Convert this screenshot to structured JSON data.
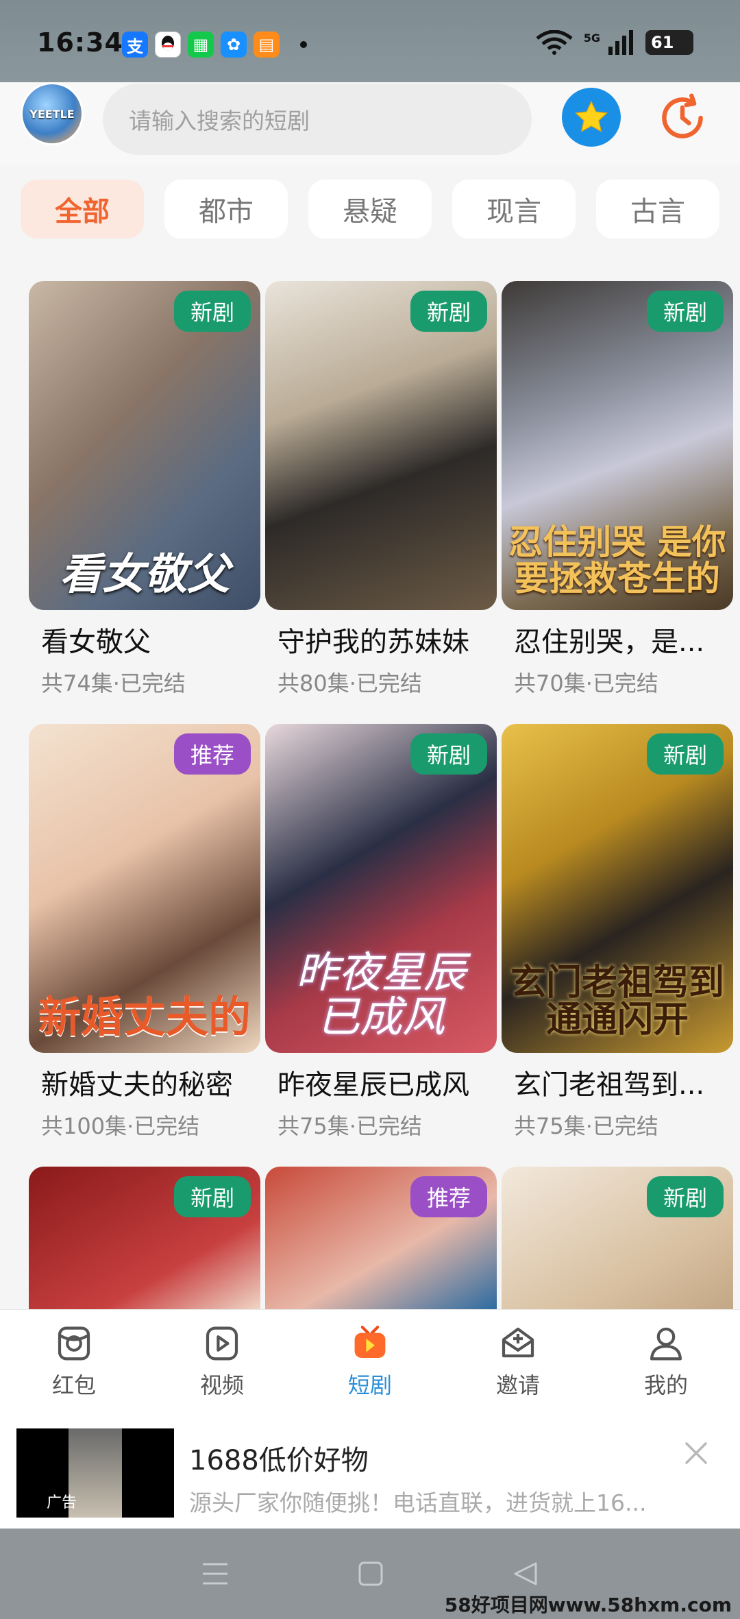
{
  "status": {
    "time": "16:34",
    "network": "5G",
    "battery": "61"
  },
  "header": {
    "avatar_text": "YEETLE",
    "search_placeholder": "请输入搜索的短剧"
  },
  "tabs": [
    {
      "label": "全部"
    },
    {
      "label": "都市"
    },
    {
      "label": "悬疑"
    },
    {
      "label": "现言"
    },
    {
      "label": "古言"
    }
  ],
  "dramas": [
    {
      "title": "看女敬父",
      "meta": "共74集·已完结",
      "badge": "新剧",
      "overlay": "看女敬父"
    },
    {
      "title": "守护我的苏妹妹",
      "meta": "共80集·已完结",
      "badge": "新剧",
      "overlay": ""
    },
    {
      "title": "忍住别哭，是...",
      "meta": "共70集·已完结",
      "badge": "新剧",
      "overlay": "忍住别哭 是你要拯救苍生的"
    },
    {
      "title": "新婚丈夫的秘密",
      "meta": "共100集·已完结",
      "badge": "推荐",
      "overlay": "新婚丈夫的"
    },
    {
      "title": "昨夜星辰已成风",
      "meta": "共75集·已完结",
      "badge": "新剧",
      "overlay": "昨夜星辰 已成风"
    },
    {
      "title": "玄门老祖驾到...",
      "meta": "共75集·已完结",
      "badge": "新剧",
      "overlay": "玄门老祖驾到 通通闪开"
    },
    {
      "title": "",
      "meta": "",
      "badge": "新剧",
      "overlay": ""
    },
    {
      "title": "",
      "meta": "",
      "badge": "推荐",
      "overlay": ""
    },
    {
      "title": "",
      "meta": "",
      "badge": "新剧",
      "overlay": ""
    }
  ],
  "nav": [
    {
      "label": "红包"
    },
    {
      "label": "视频"
    },
    {
      "label": "短剧"
    },
    {
      "label": "邀请"
    },
    {
      "label": "我的"
    }
  ],
  "ad": {
    "thumb_label": "广告",
    "title": "1688低价好物",
    "description": "源头厂家你随便挑！电话直联，进货就上16..."
  },
  "watermark": "58好项目网www.58hxm.com"
}
